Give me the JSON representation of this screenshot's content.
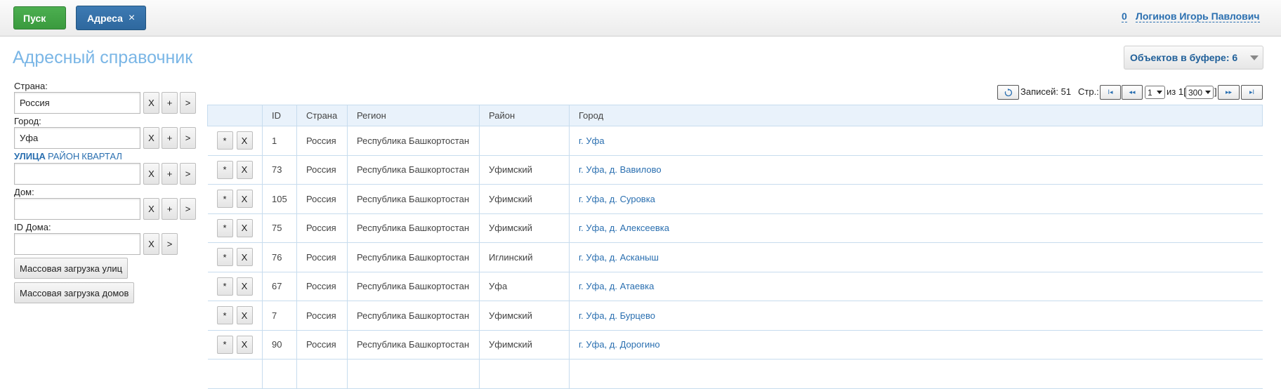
{
  "topbar": {
    "start_label": "Пуск",
    "tab_label": "Адреса",
    "tab_close": "×",
    "notifications": "0",
    "user_name": "Логинов Игорь Павлович"
  },
  "page_title": "Адресный справочник",
  "buffer_label": "Объектов в буфере: 6",
  "form": {
    "country_label": "Страна:",
    "country_value": "Россия",
    "city_label": "Город:",
    "city_value": "Уфа",
    "switch": [
      "УЛИЦА",
      "РАЙОН",
      "КВАРТАЛ"
    ],
    "street_value": "",
    "house_label": "Дом:",
    "house_value": "",
    "house_id_label": "ID Дома:",
    "house_id_value": "",
    "btn_clear": "X",
    "btn_add": "+",
    "btn_go": ">",
    "bulk_streets": "Массовая загрузка улиц",
    "bulk_houses": "Массовая загрузка домов"
  },
  "pager": {
    "refresh_icon": "refresh-icon",
    "records": "Записей: 51",
    "page_label": "Стр.:",
    "page_value": "1",
    "of_label": "из 1[",
    "per_page": "300",
    "close_bracket": "]",
    "first": "I◂",
    "prev": "◂◂",
    "next": "▸▸",
    "last": "▸I"
  },
  "table": {
    "columns": [
      "",
      "ID",
      "Страна",
      "Регион",
      "Район",
      "Город"
    ],
    "star": "*",
    "del": "X",
    "rows": [
      [
        "1",
        "Россия",
        "Республика Башкортостан",
        "",
        "г. Уфа"
      ],
      [
        "73",
        "Россия",
        "Республика Башкортостан",
        "Уфимский",
        "г. Уфа, д. Вавилово"
      ],
      [
        "105",
        "Россия",
        "Республика Башкортостан",
        "Уфимский",
        "г. Уфа, д. Суровка"
      ],
      [
        "75",
        "Россия",
        "Республика Башкортостан",
        "Уфимский",
        "г. Уфа, д. Алексеевка"
      ],
      [
        "76",
        "Россия",
        "Республика Башкортостан",
        "Иглинский",
        "г. Уфа, д. Асканыш"
      ],
      [
        "67",
        "Россия",
        "Республика Башкортостан",
        "Уфа",
        "г. Уфа, д. Атаевка"
      ],
      [
        "7",
        "Россия",
        "Республика Башкортостан",
        "Уфимский",
        "г. Уфа, д. Бурцево"
      ],
      [
        "90",
        "Россия",
        "Республика Башкортостан",
        "Уфимский",
        "г. Уфа, д. Дорогино"
      ],
      [
        "",
        "",
        "",
        "",
        ""
      ]
    ]
  }
}
